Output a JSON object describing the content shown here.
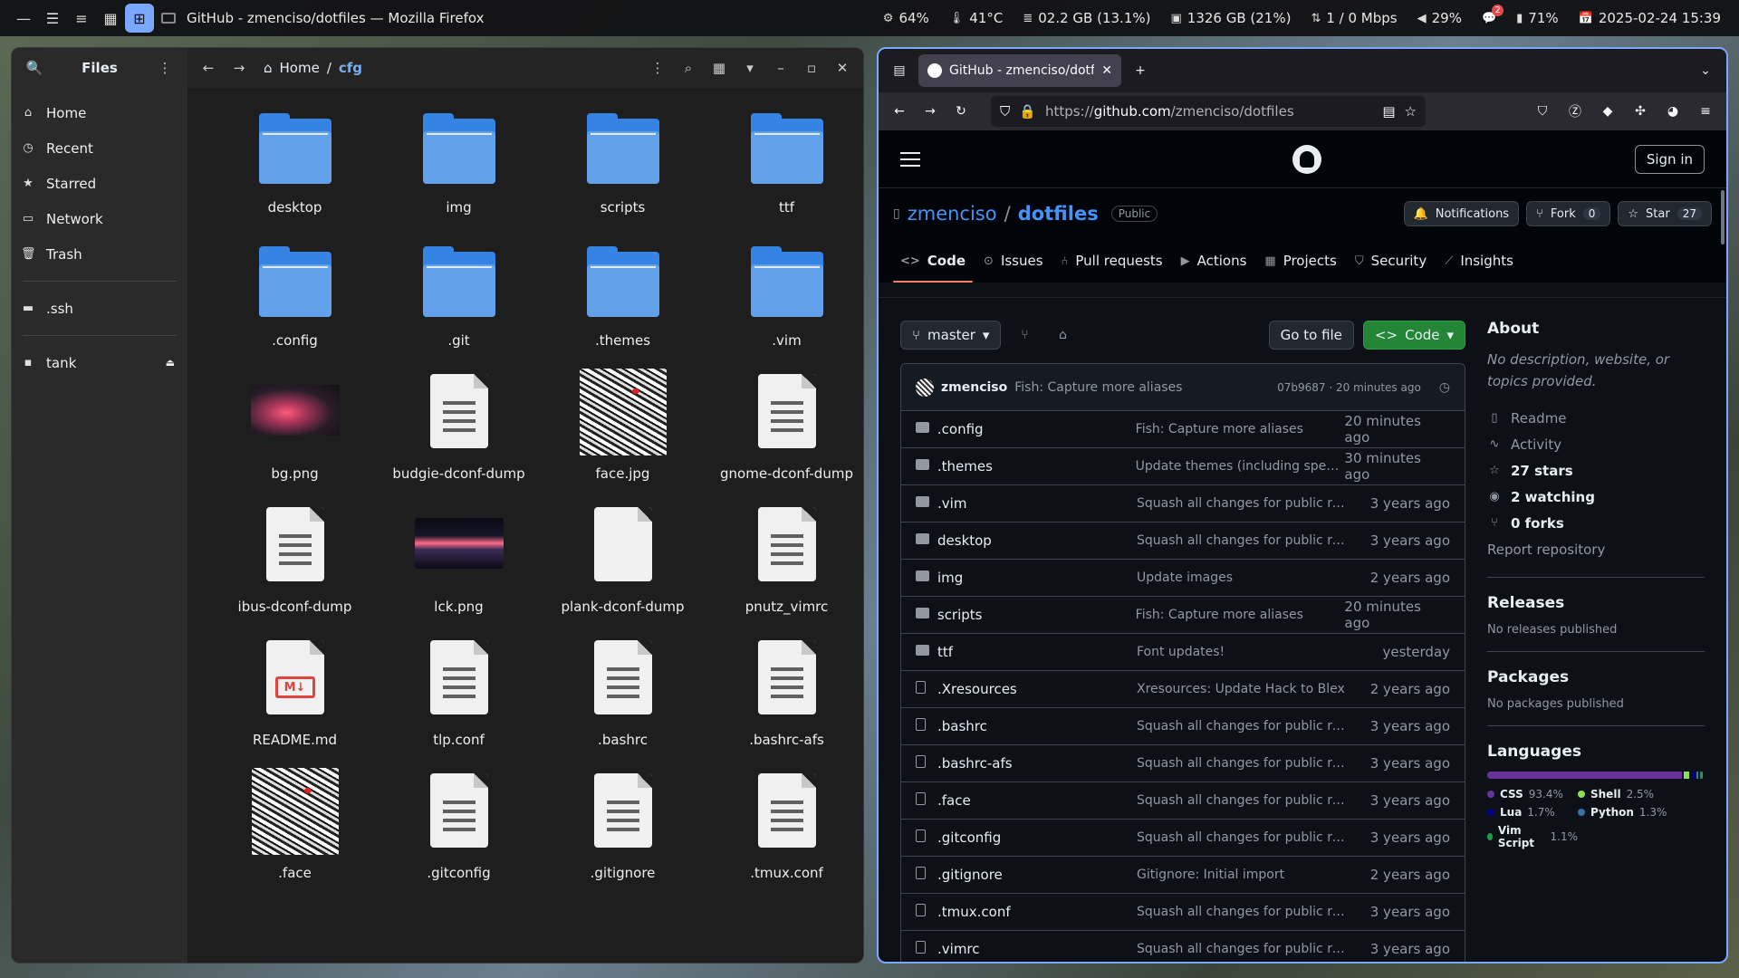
{
  "panel": {
    "window_title": "GitHub - zmenciso/dotfiles — Mozilla Firefox",
    "cpu": "64%",
    "temp": "41°C",
    "mem": "02.2 GB (13.1%)",
    "disk": "1326 GB (21%)",
    "net": "1 / 0 Mbps",
    "volume": "29%",
    "notif_count": "2",
    "battery": "71%",
    "datetime": "2025-02-24 15:39"
  },
  "files": {
    "title": "Files",
    "crumb_home": "Home",
    "crumb_sep": "/",
    "crumb_current": "cfg",
    "sidebar": [
      "Home",
      "Recent",
      "Starred",
      "Network",
      "Trash"
    ],
    "bookmarks": [
      ".ssh"
    ],
    "devices": [
      "tank"
    ],
    "items": [
      {
        "label": "desktop",
        "kind": "folder"
      },
      {
        "label": "img",
        "kind": "folder"
      },
      {
        "label": "scripts",
        "kind": "folder"
      },
      {
        "label": "ttf",
        "kind": "folder"
      },
      {
        "label": ".config",
        "kind": "folder"
      },
      {
        "label": ".git",
        "kind": "folder"
      },
      {
        "label": ".themes",
        "kind": "folder"
      },
      {
        "label": ".vim",
        "kind": "folder"
      },
      {
        "label": "bg.png",
        "kind": "image-bg"
      },
      {
        "label": "budgie-dconf-dump",
        "kind": "text"
      },
      {
        "label": "face.jpg",
        "kind": "image-face"
      },
      {
        "label": "gnome-dconf-dump",
        "kind": "text"
      },
      {
        "label": "ibus-dconf-dump",
        "kind": "text"
      },
      {
        "label": "lck.png",
        "kind": "image-lck"
      },
      {
        "label": "plank-dconf-dump",
        "kind": "blank"
      },
      {
        "label": "pnutz_vimrc",
        "kind": "text"
      },
      {
        "label": "README.md",
        "kind": "markdown"
      },
      {
        "label": "tlp.conf",
        "kind": "text"
      },
      {
        "label": ".bashrc",
        "kind": "text"
      },
      {
        "label": ".bashrc-afs",
        "kind": "text"
      },
      {
        "label": ".face",
        "kind": "image-face"
      },
      {
        "label": ".gitconfig",
        "kind": "text"
      },
      {
        "label": ".gitignore",
        "kind": "text"
      },
      {
        "label": ".tmux.conf",
        "kind": "text"
      }
    ]
  },
  "firefox": {
    "tab_title": "GitHub - zmenciso/dotfile",
    "url_prefix": "https://",
    "url_host": "github.com",
    "url_path": "/zmenciso/dotfiles"
  },
  "github": {
    "sign_in": "Sign in",
    "owner": "zmenciso",
    "repo": "dotfiles",
    "visibility": "Public",
    "notifications": "Notifications",
    "fork_label": "Fork",
    "fork_count": "0",
    "star_label": "Star",
    "star_count": "27",
    "tabs": [
      "Code",
      "Issues",
      "Pull requests",
      "Actions",
      "Projects",
      "Security",
      "Insights"
    ],
    "branch": "master",
    "go_to_file": "Go to file",
    "code_button": "Code",
    "commit": {
      "author": "zmenciso",
      "message": "Fish: Capture more aliases",
      "meta": "07b9687 · 20 minutes ago"
    },
    "files": [
      {
        "name": ".config",
        "type": "dir",
        "msg": "Fish: Capture more aliases",
        "date": "20 minutes ago"
      },
      {
        "name": ".themes",
        "type": "dir",
        "msg": "Update themes (including speci...",
        "date": "30 minutes ago"
      },
      {
        "name": ".vim",
        "type": "dir",
        "msg": "Squash all changes for public re...",
        "date": "3 years ago"
      },
      {
        "name": "desktop",
        "type": "dir",
        "msg": "Squash all changes for public re...",
        "date": "3 years ago"
      },
      {
        "name": "img",
        "type": "dir",
        "msg": "Update images",
        "date": "2 years ago"
      },
      {
        "name": "scripts",
        "type": "dir",
        "msg": "Fish: Capture more aliases",
        "date": "20 minutes ago"
      },
      {
        "name": "ttf",
        "type": "dir",
        "msg": "Font updates!",
        "date": "yesterday"
      },
      {
        "name": ".Xresources",
        "type": "file",
        "msg": "Xresources: Update Hack to Blex",
        "date": "2 years ago"
      },
      {
        "name": ".bashrc",
        "type": "file",
        "msg": "Squash all changes for public re...",
        "date": "3 years ago"
      },
      {
        "name": ".bashrc-afs",
        "type": "file",
        "msg": "Squash all changes for public re...",
        "date": "3 years ago"
      },
      {
        "name": ".face",
        "type": "file",
        "msg": "Squash all changes for public re...",
        "date": "3 years ago"
      },
      {
        "name": ".gitconfig",
        "type": "file",
        "msg": "Squash all changes for public re...",
        "date": "3 years ago"
      },
      {
        "name": ".gitignore",
        "type": "file",
        "msg": "Gitignore: Initial import",
        "date": "2 years ago"
      },
      {
        "name": ".tmux.conf",
        "type": "file",
        "msg": "Squash all changes for public re...",
        "date": "3 years ago"
      },
      {
        "name": ".vimrc",
        "type": "file",
        "msg": "Squash all changes for public re...",
        "date": "3 years ago"
      }
    ],
    "about": {
      "title": "About",
      "desc": "No description, website, or topics provided.",
      "readme": "Readme",
      "activity": "Activity",
      "stars": "27 stars",
      "watching": "2 watching",
      "forks": "0 forks",
      "report": "Report repository"
    },
    "releases": {
      "title": "Releases",
      "text": "No releases published"
    },
    "packages": {
      "title": "Packages",
      "text": "No packages published"
    },
    "languages": {
      "title": "Languages",
      "items": [
        {
          "name": "CSS",
          "pct": "93.4%",
          "value": 93.4,
          "color": "#663399"
        },
        {
          "name": "Shell",
          "pct": "2.5%",
          "value": 2.5,
          "color": "#89e051"
        },
        {
          "name": "Lua",
          "pct": "1.7%",
          "value": 1.7,
          "color": "#000080"
        },
        {
          "name": "Python",
          "pct": "1.3%",
          "value": 1.3,
          "color": "#3572A5"
        },
        {
          "name": "Vim Script",
          "pct": "1.1%",
          "value": 1.1,
          "color": "#199f4b"
        }
      ]
    }
  }
}
